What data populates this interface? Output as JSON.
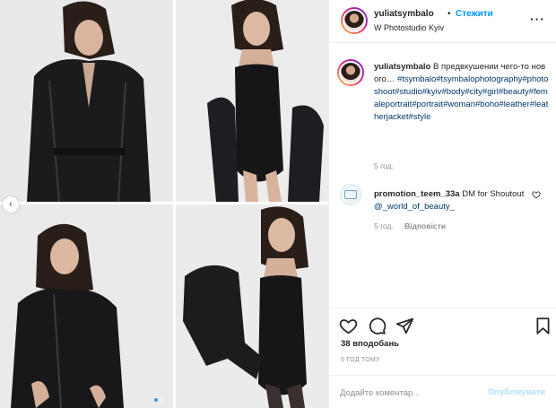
{
  "post": {
    "username": "yuliatsymbalo",
    "separator": "•",
    "follow_label": "Стежити",
    "location": "W Photostudio Kyiv",
    "more_icon": "more-horizontal-icon"
  },
  "caption": {
    "username": "yuliatsymbalo",
    "text": "В предвкушении чего-то нового…",
    "hashtags": "#tsymbalo#tsymbalophotography#photoshoot#studio#kyiv#body#city#girl#beauty#femaleportrait#portrait#woman#boho#leather#leatherjacket#style",
    "time": "5 год."
  },
  "comment": {
    "username": "promotion_teem_33a",
    "text": "DM for Shoutout",
    "mention": "@_world_of_beauty_",
    "time": "5 год.",
    "reply_label": "Відповісти"
  },
  "actions": {
    "like_icon": "heart-outline-icon",
    "comment_icon": "comment-bubble-icon",
    "share_icon": "paper-plane-icon",
    "save_icon": "bookmark-icon"
  },
  "likes_label": "38 вподобань",
  "post_time": "5 ГОД ТОМУ",
  "add_comment": {
    "placeholder": "Додайте коментар...",
    "publish_label": "Опублікувати"
  },
  "carousel": {
    "prev_icon": "chevron-left-icon",
    "dots_count": 2,
    "active_dot": 0
  },
  "colors": {
    "link_blue": "#0095f6",
    "hashtag_blue": "#00376b",
    "muted_gray": "#8e8e8e",
    "publish_disabled": "#b2dffc"
  }
}
